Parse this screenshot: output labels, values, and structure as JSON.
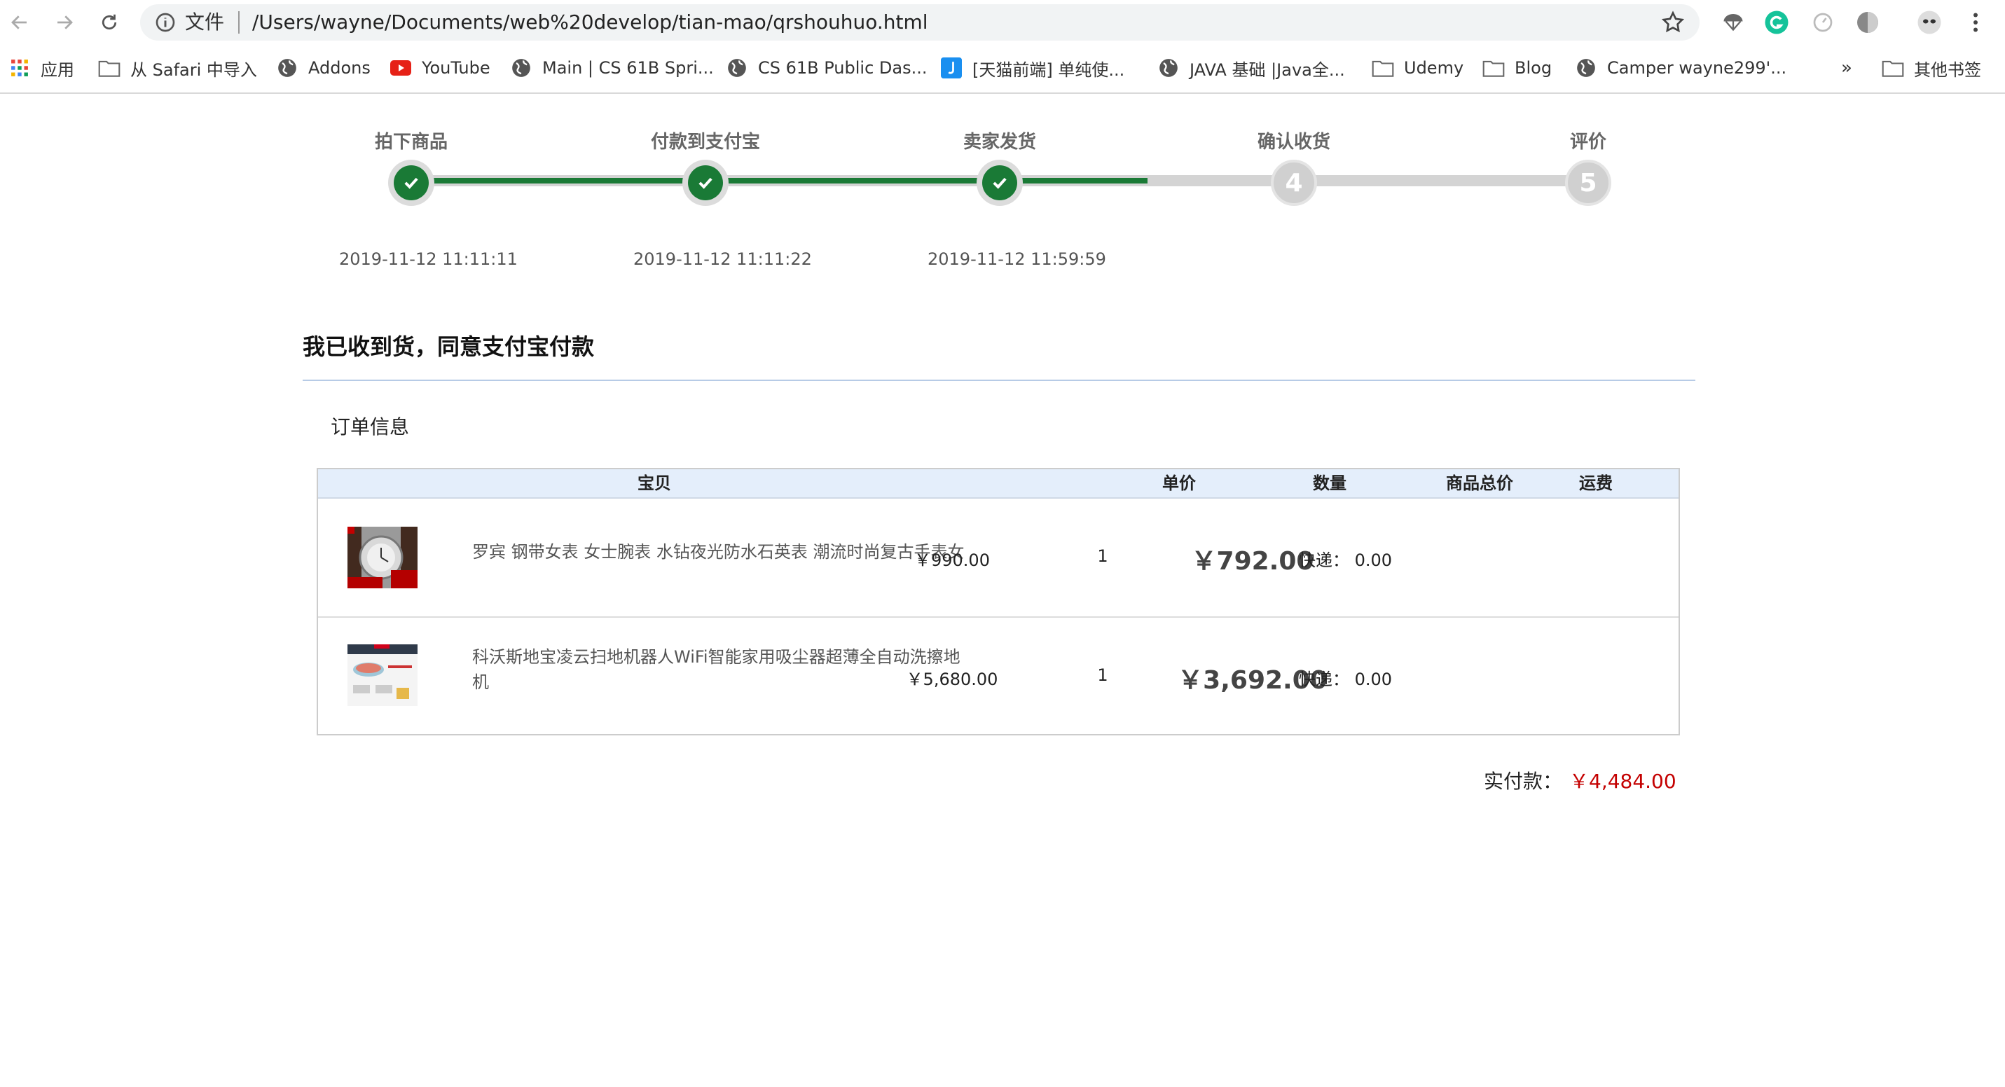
{
  "browser": {
    "url_scheme": "文件",
    "url": "/Users/wayne/Documents/web%20develop/tian-mao/qrshouhuo.html",
    "bookmarks": [
      {
        "label": "应用",
        "icon": "apps-grid-icon"
      },
      {
        "label": "从 Safari 中导入",
        "icon": "folder-icon"
      },
      {
        "label": "Addons",
        "icon": "globe-icon"
      },
      {
        "label": "YouTube",
        "icon": "youtube-icon"
      },
      {
        "label": "Main | CS 61B Spri...",
        "icon": "globe-icon"
      },
      {
        "label": "CS 61B Public Das...",
        "icon": "globe-icon"
      },
      {
        "label": "[天猫前端] 单纯使...",
        "icon": "jsfiddle-icon"
      },
      {
        "label": "JAVA 基础 |Java全...",
        "icon": "globe-icon"
      },
      {
        "label": "Udemy",
        "icon": "folder-icon"
      },
      {
        "label": "Blog",
        "icon": "folder-icon"
      },
      {
        "label": "Camper wayne299'...",
        "icon": "globe-icon"
      }
    ],
    "overflow_label": "»",
    "other_bookmarks": "其他书签"
  },
  "progress": {
    "steps": [
      {
        "label": "拍下商品",
        "done": true,
        "time": "2019-11-12 11:11:11"
      },
      {
        "label": "付款到支付宝",
        "done": true,
        "time": "2019-11-12 11:11:22"
      },
      {
        "label": "卖家发货",
        "done": true,
        "time": "2019-11-12 11:59:59"
      },
      {
        "label": "确认收货",
        "done": false,
        "number": "4"
      },
      {
        "label": "评价",
        "done": false,
        "number": "5"
      }
    ],
    "completed_fraction": 0.625
  },
  "confirm": {
    "title": "我已收到货，同意支付宝付款"
  },
  "order": {
    "section_title": "订单信息",
    "columns": [
      "宝贝",
      "单价",
      "数量",
      "商品总价",
      "运费"
    ],
    "items": [
      {
        "name": "罗宾 钢带女表 女士腕表 水钻夜光防水石英表 潮流时尚复古手表女",
        "unit_price": "￥990.00",
        "quantity": "1",
        "total": "￥792.00",
        "shipping_label": "快递：",
        "shipping_fee": "0.00"
      },
      {
        "name": "科沃斯地宝凌云扫地机器人WiFi智能家用吸尘器超薄全自动洗擦地机",
        "unit_price": "￥5,680.00",
        "quantity": "1",
        "total": "￥3,692.00",
        "shipping_label": "快递：",
        "shipping_fee": "0.00"
      }
    ],
    "paid_label": "实付款：",
    "paid_value": "￥4,484.00"
  },
  "colors": {
    "progress_green": "#1a7a36",
    "price_red": "#c40000",
    "header_blue": "#e4eefb"
  }
}
